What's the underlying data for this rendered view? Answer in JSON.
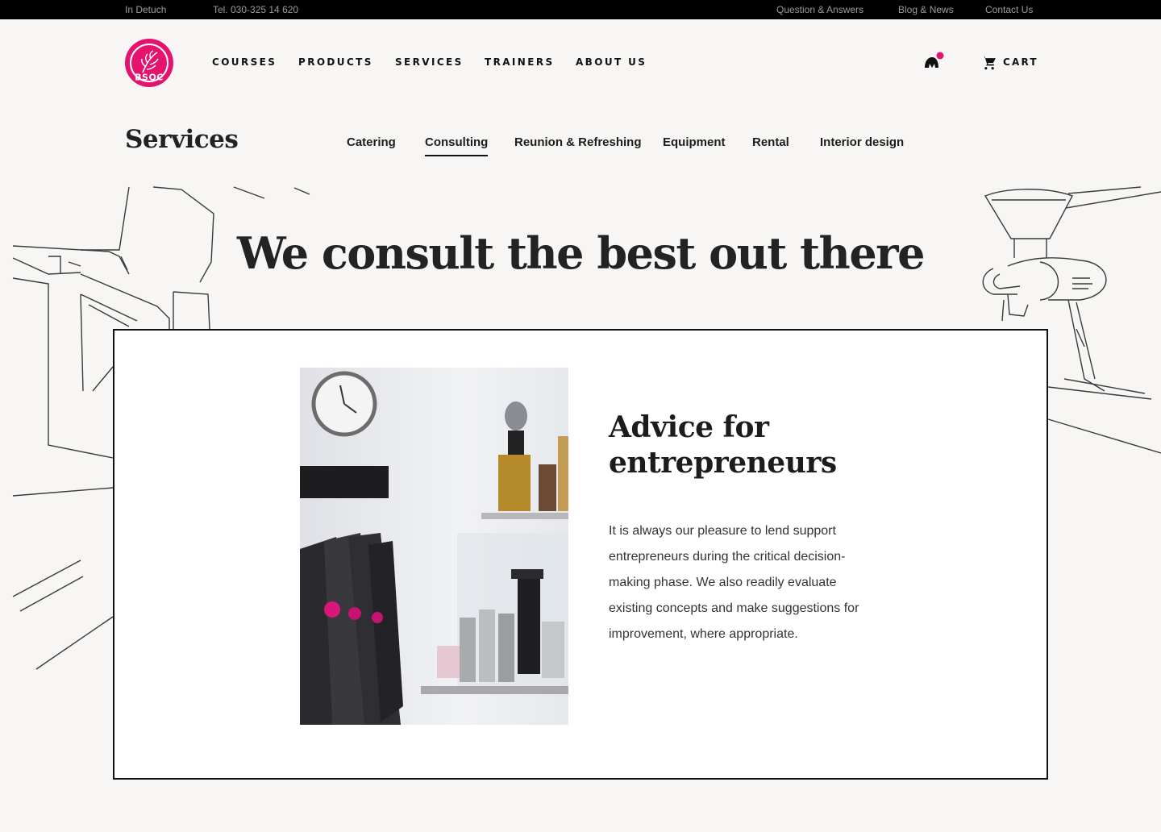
{
  "topbar": {
    "language": "In Detuch",
    "phone": "Tel. 030-325 14 620",
    "links": [
      "Question & Answers",
      "Blog & News",
      "Contact Us"
    ]
  },
  "header": {
    "logo_text": "BSOC",
    "nav": [
      "COURSES",
      "PRODUCTS",
      "SERVICES",
      "TRAINERS",
      "ABOUT US"
    ],
    "cart_label": "CART"
  },
  "services": {
    "title": "Services",
    "tabs": [
      "Catering",
      "Consulting",
      "Reunion & Refreshing",
      "Equipment",
      "Rental",
      "Interior design"
    ],
    "active_tab": "Consulting"
  },
  "hero": {
    "title": "We consult the best out there"
  },
  "card": {
    "title": "Advice for entrepreneurs",
    "text": "It is always our pleasure to lend support entrepreneurs during the critical decision-making phase. We also readily evaluate existing concepts and make suggestions for improvement, where appropriate."
  },
  "colors": {
    "accent": "#e5126e",
    "topbar_bg": "#000000",
    "page_bg": "#f7f6f4"
  },
  "icons": {
    "account": "account-icon",
    "cart": "cart-icon"
  }
}
